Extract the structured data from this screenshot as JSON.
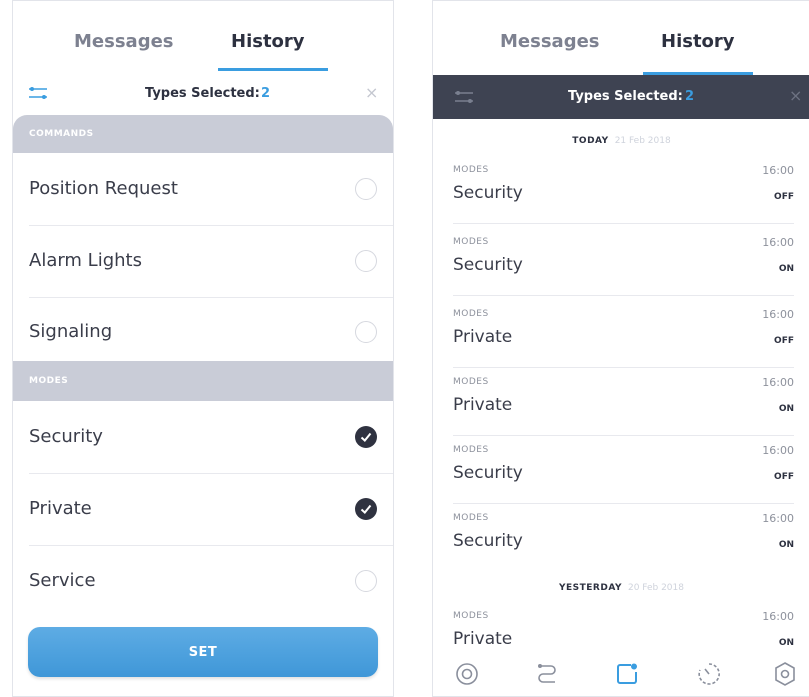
{
  "left": {
    "tabs": {
      "messages": "Messages",
      "history": "History"
    },
    "filter": {
      "label": "Types Selected:",
      "count": "2",
      "close": "×"
    },
    "sections": [
      {
        "header": "COMMANDS",
        "items": [
          {
            "label": "Position Request",
            "checked": false
          },
          {
            "label": "Alarm Lights",
            "checked": false
          },
          {
            "label": "Signaling",
            "checked": false
          }
        ]
      },
      {
        "header": "MODES",
        "items": [
          {
            "label": "Security",
            "checked": true
          },
          {
            "label": "Private",
            "checked": true
          },
          {
            "label": "Service",
            "checked": false
          }
        ]
      }
    ],
    "set_button": "SET"
  },
  "right": {
    "tabs": {
      "messages": "Messages",
      "history": "History"
    },
    "filter": {
      "label": "Types Selected:",
      "count": "2",
      "close": "×"
    },
    "days": [
      {
        "label": "TODAY",
        "date": "21 Feb 2018",
        "entries": [
          {
            "category": "MODES",
            "name": "Security",
            "time": "16:00",
            "status": "OFF"
          },
          {
            "category": "MODES",
            "name": "Security",
            "time": "16:00",
            "status": "ON"
          },
          {
            "category": "MODES",
            "name": "Private",
            "time": "16:00",
            "status": "OFF"
          },
          {
            "category": "MODES",
            "name": "Private",
            "time": "16:00",
            "status": "ON"
          },
          {
            "category": "MODES",
            "name": "Security",
            "time": "16:00",
            "status": "OFF"
          },
          {
            "category": "MODES",
            "name": "Security",
            "time": "16:00",
            "status": "ON"
          }
        ]
      },
      {
        "label": "YESTERDAY",
        "date": "20 Feb 2018",
        "entries": [
          {
            "category": "MODES",
            "name": "Private",
            "time": "16:00",
            "status": "ON"
          }
        ]
      }
    ],
    "nav": [
      {
        "icon": "target-icon",
        "active": false
      },
      {
        "icon": "route-icon",
        "active": false
      },
      {
        "icon": "history-icon",
        "active": true
      },
      {
        "icon": "timer-icon",
        "active": false
      },
      {
        "icon": "shield-icon",
        "active": false
      }
    ]
  },
  "colors": {
    "accent": "#3a9de0",
    "dark_bar": "#3e4352",
    "section_header": "#c9ccd7",
    "check_fill": "#2f3240"
  }
}
